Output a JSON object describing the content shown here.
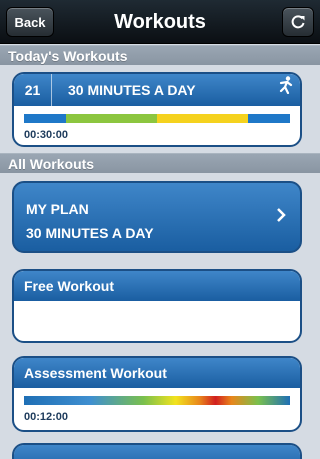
{
  "navbar": {
    "back_label": "Back",
    "title": "Workouts",
    "refresh_icon": "refresh-icon"
  },
  "sections": {
    "today": "Today's Workouts",
    "all": "All Workouts"
  },
  "today_workout": {
    "day": "21",
    "title": "30 MINUTES A DAY",
    "time": "00:30:00",
    "icon": "runner-icon",
    "bar_colors": [
      "#1f78c8",
      "#8cc63f",
      "#f5d21e",
      "#1f78c8"
    ]
  },
  "plan": {
    "line1": "MY PLAN",
    "line2": "30 MINUTES A DAY",
    "icon": "chevron-right-icon"
  },
  "free_workout": {
    "title": "Free Workout"
  },
  "assessment": {
    "title": "Assessment Workout",
    "time": "00:12:00"
  }
}
